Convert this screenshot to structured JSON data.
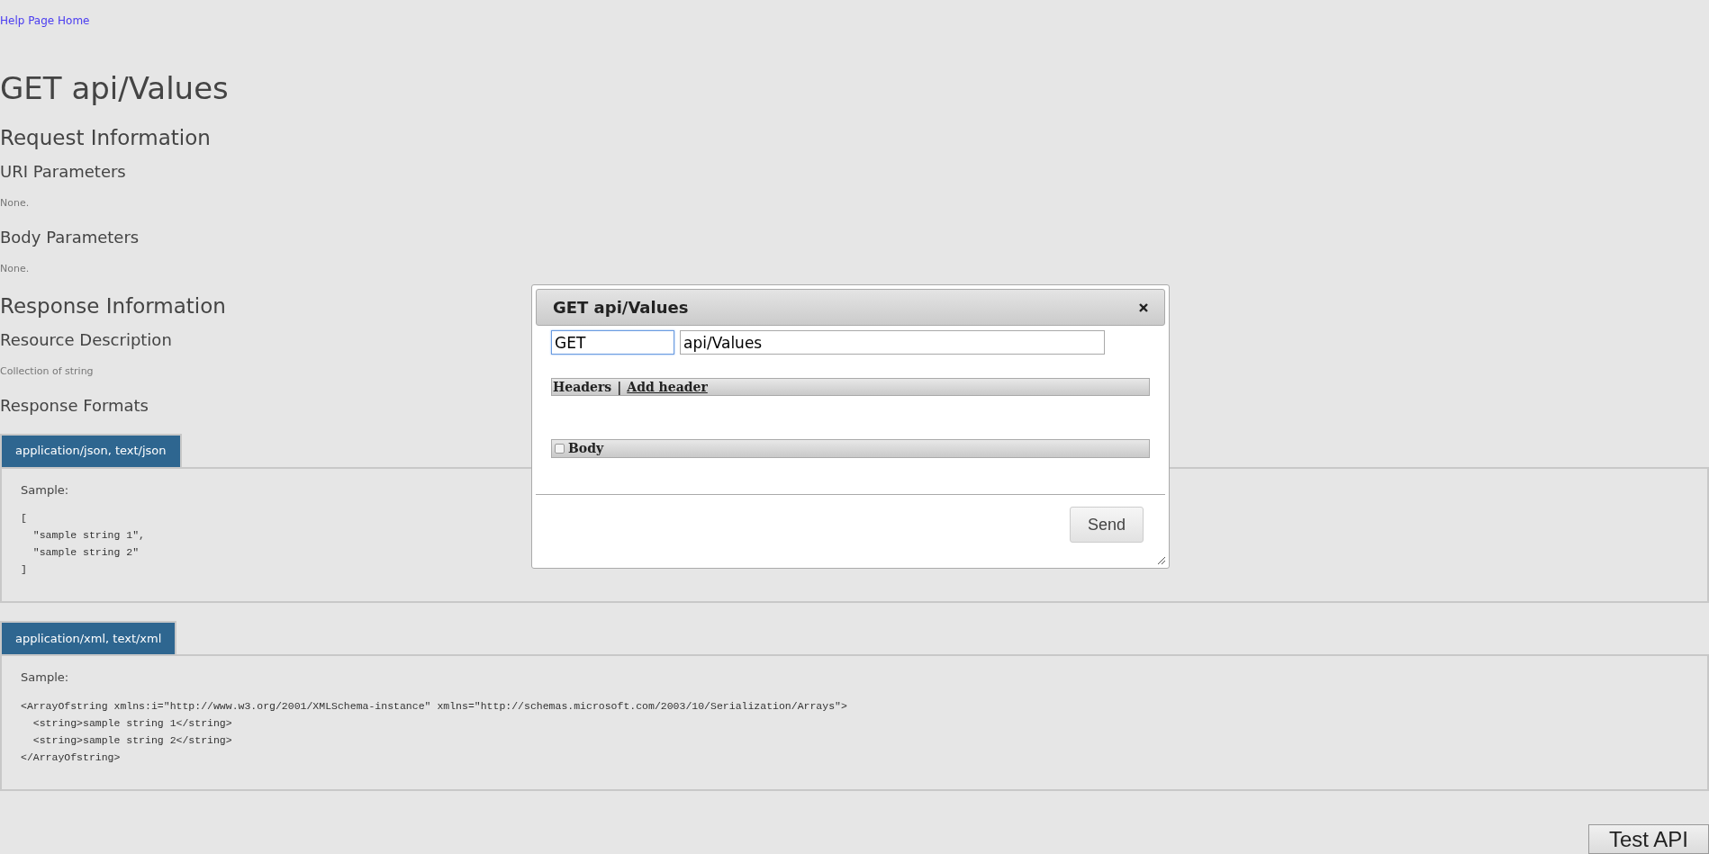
{
  "help_link": "Help Page Home",
  "title": "GET api/Values",
  "content": [
    {
      "kind": "section",
      "text": "Request Information"
    },
    {
      "kind": "subsection",
      "text": "URI Parameters"
    },
    {
      "kind": "text",
      "text": "None."
    },
    {
      "kind": "subsection",
      "text": "Body Parameters"
    },
    {
      "kind": "text",
      "text": "None."
    },
    {
      "kind": "section",
      "text": "Response Information"
    },
    {
      "kind": "subsection",
      "text": "Resource Description"
    },
    {
      "kind": "text",
      "text": "Collection of string"
    },
    {
      "kind": "subsection",
      "text": "Response Formats"
    }
  ],
  "response_formats": [
    {
      "label": "application/json, text/json",
      "sample_label": "Sample:",
      "sample_lines": [
        "[",
        "  \"sample string 1\",",
        "  \"sample string 2\"",
        "]"
      ]
    },
    {
      "label": "application/xml, text/xml",
      "sample_label": "Sample:",
      "sample_lines": [
        "<ArrayOfstring xmlns:i=\"http://www.w3.org/2001/XMLSchema-instance\" xmlns=\"http://schemas.microsoft.com/2003/10/Serialization/Arrays\">",
        "  <string>sample string 1</string>",
        "  <string>sample string 2</string>",
        "</ArrayOfstring>"
      ]
    }
  ],
  "dialog": {
    "title": "GET api/Values",
    "method": {
      "value": "GET",
      "focused": true
    },
    "url": {
      "value": "api/Values",
      "focused": false
    },
    "headers_label": "Headers",
    "separator": "|",
    "add_header": "Add header",
    "body": {
      "label": "Body",
      "checked": false
    },
    "send": "Send"
  },
  "test_api_button": "Test API"
}
